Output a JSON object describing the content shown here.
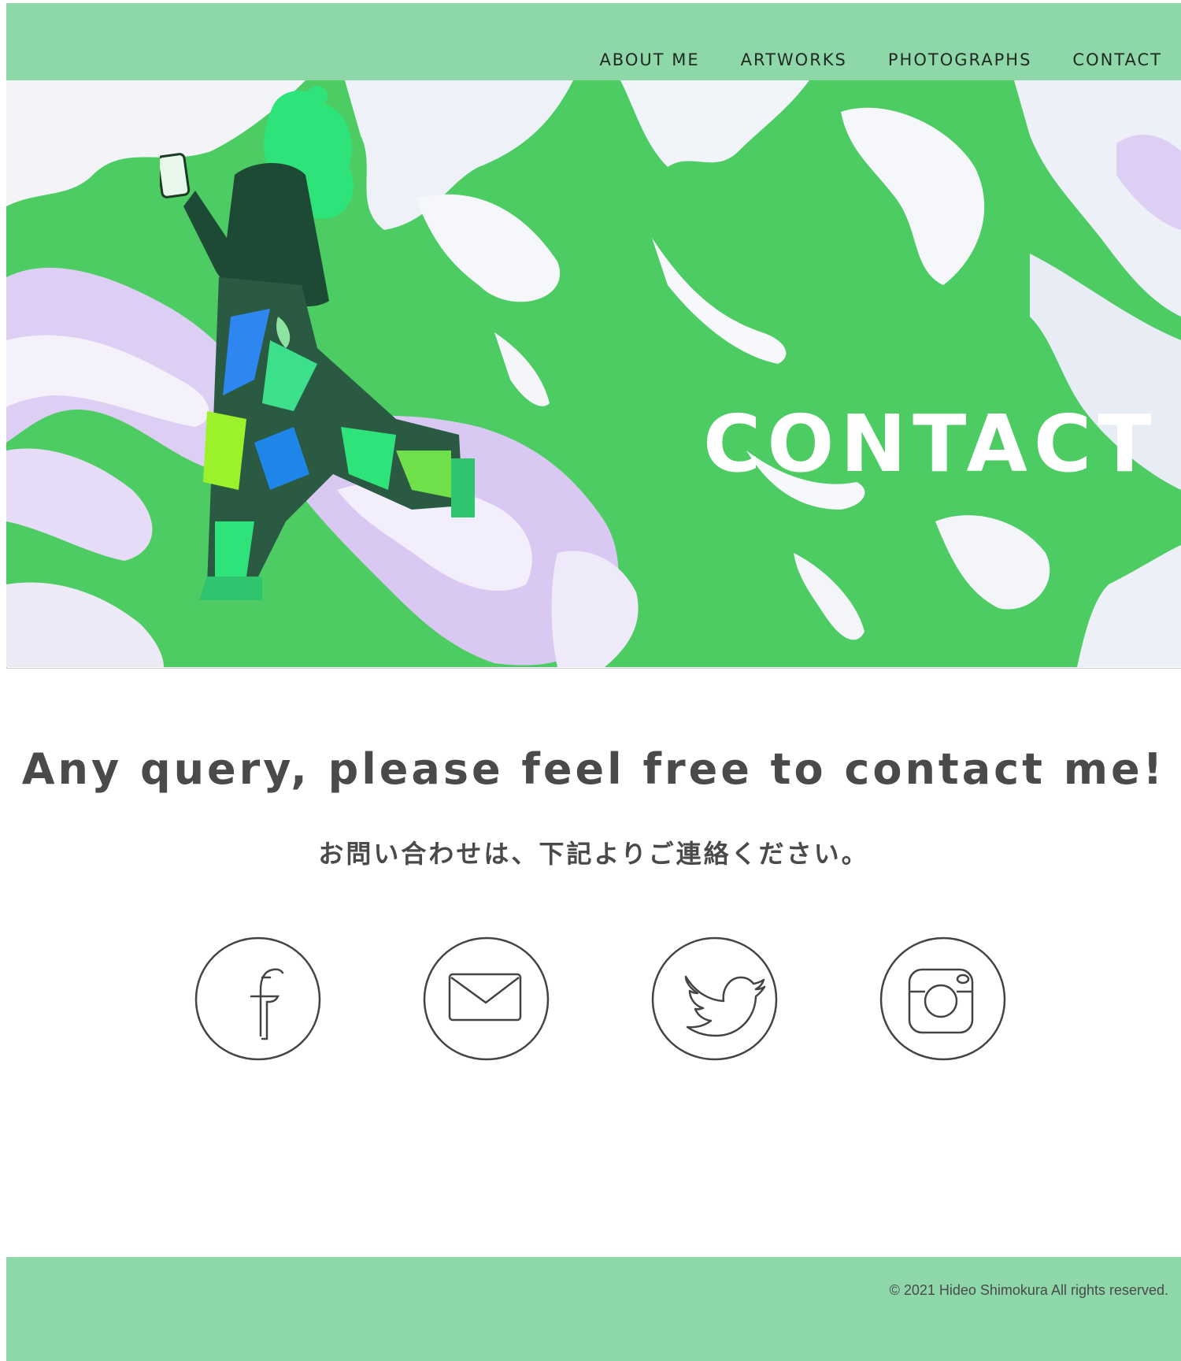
{
  "nav": {
    "items": [
      {
        "label": "ABOUT ME"
      },
      {
        "label": "ARTWORKS"
      },
      {
        "label": "PHOTOGRAPHS"
      },
      {
        "label": "CONTACT"
      }
    ]
  },
  "hero": {
    "title": "CONTACT"
  },
  "content": {
    "headline": "Any query, please feel free to contact me!",
    "subline": "お問い合わせは、下記よりご連絡ください。",
    "social_icons": [
      "facebook-icon",
      "mail-icon",
      "twitter-icon",
      "instagram-icon"
    ]
  },
  "footer": {
    "copyright": "© 2021 Hideo Shimokura All rights reserved."
  },
  "colors": {
    "header_bg": "#8dd7a9",
    "marble_green": "#4dcc64",
    "marble_lilac": "#d9c9f2",
    "text_dark": "#4a4a4a"
  }
}
